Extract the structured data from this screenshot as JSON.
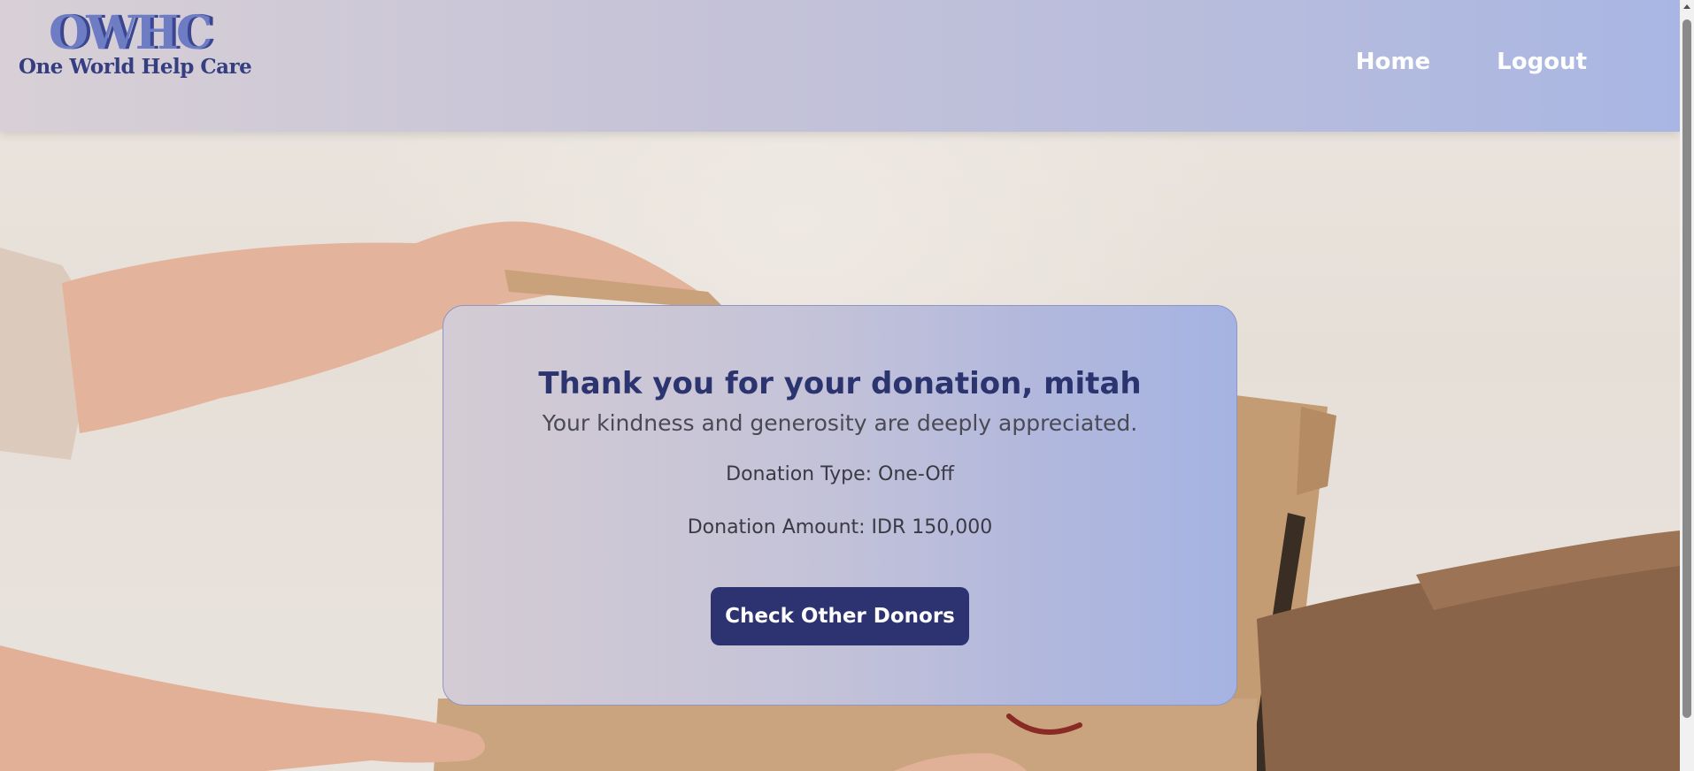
{
  "header": {
    "logo_mark": "OWHC",
    "logo_name": "One World Help Care",
    "nav": {
      "home_label": "Home",
      "logout_label": "Logout"
    }
  },
  "confirmation": {
    "title": "Thank you for your donation, mitah",
    "subtitle": "Your kindness and generosity are deeply appreciated.",
    "type_line": "Donation Type: One-Off",
    "amount_line": "Donation Amount: IDR 150,000",
    "button_label": "Check Other Donors"
  },
  "colors": {
    "brand_dark": "#2d3370",
    "header_gradient_start": "#d8d0d6",
    "header_gradient_end": "#a9b6e3"
  },
  "background_image": "hands-passing-cardboard-box-photo"
}
